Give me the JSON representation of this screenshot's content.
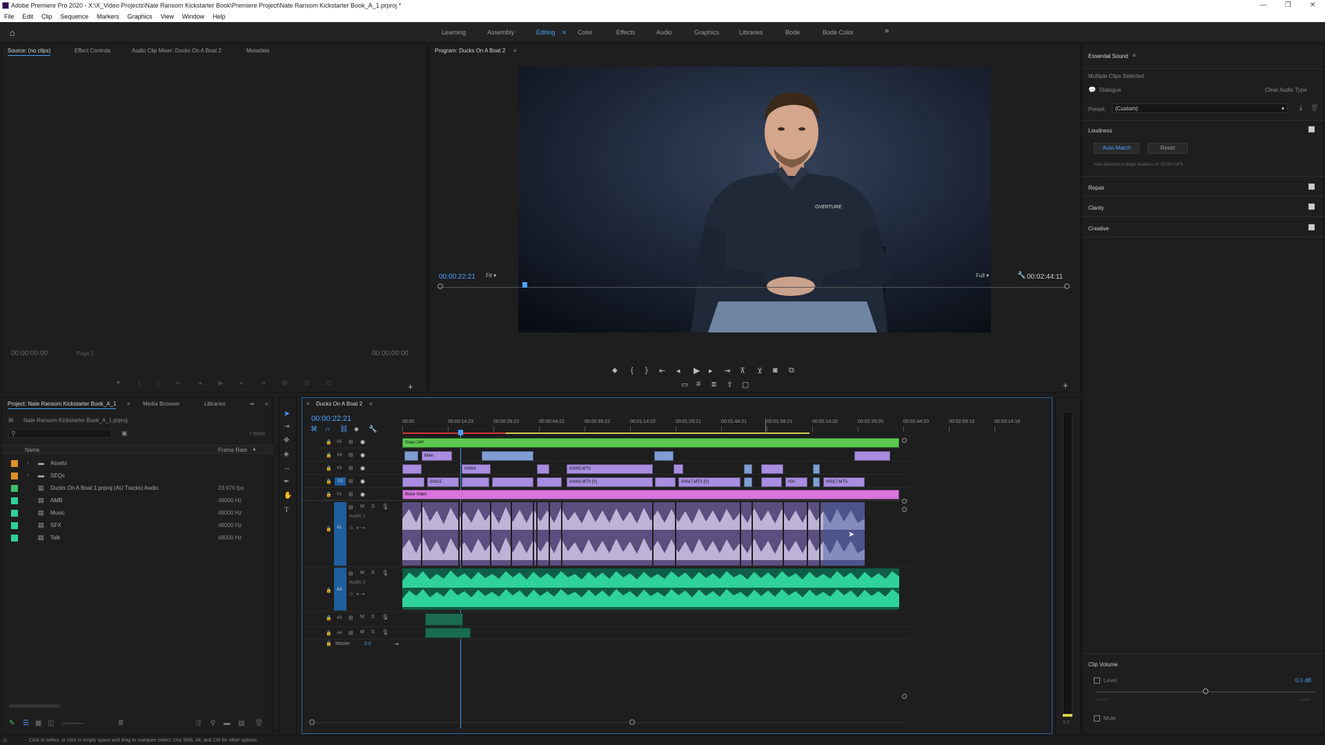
{
  "window": {
    "title": "Adobe Premiere Pro 2020 - X:\\X_Video Projects\\Nate Ransom Kickstarter Book\\Premiere Project\\Nate Ransom Kickstarter Book_A_1.prproj *"
  },
  "menu": [
    "File",
    "Edit",
    "Clip",
    "Sequence",
    "Markers",
    "Graphics",
    "View",
    "Window",
    "Help"
  ],
  "workspaces": [
    "Learning",
    "Assembly",
    "Editing",
    "Color",
    "Effects",
    "Audio",
    "Graphics",
    "Libraries",
    "Bode",
    "Bode Color"
  ],
  "active_workspace": "Editing",
  "source_panel": {
    "tabs": [
      "Source: (no clips)",
      "Effect Controls",
      "Audio Clip Mixer: Ducks On A Boat 2",
      "Metadata"
    ],
    "timecode_left": "00:00:00:00",
    "page": "Page 1",
    "timecode_right": "00:00:00:00"
  },
  "program_panel": {
    "title": "Program: Ducks On A Boat 2",
    "timecode": "00:00:22:21",
    "fit": "Fit",
    "resolution": "Full",
    "duration": "00:02:44:11",
    "shirt_logo": "OVERTURE",
    "playhead_fraction": 0.133
  },
  "essential_sound": {
    "title": "Essential Sound",
    "status": "Multiple Clips Selected",
    "type": "Dialogue",
    "clear": "Clear Audio Type",
    "preset_label": "Preset:",
    "preset_value": "(Custom)",
    "loudness": "Loudness",
    "auto_match": "Auto-Match",
    "reset": "Reset",
    "note": "Auto-Matched to target loudness of -23.00 LUFS",
    "sections": [
      "Repair",
      "Clarity",
      "Creative"
    ],
    "clip_volume": "Clip Volume",
    "level": "Level",
    "level_value": "0.0 dB",
    "quieter": "Quieter",
    "louder": "Louder",
    "mute": "Mute",
    "level_fraction": 0.5
  },
  "project_panel": {
    "tabs": [
      "Project: Nate Ransom Kickstarter Book_A_1",
      "Media Browser",
      "Libraries"
    ],
    "file": "Nate Ransom Kickstarter Book_A_1.prproj",
    "items_count": "7 Items",
    "col_name": "Name",
    "col_rate": "Frame Rate",
    "items": [
      {
        "name": "Assets",
        "rate": "",
        "color": "#e0902a",
        "kind": "folder"
      },
      {
        "name": "SEQs",
        "rate": "",
        "color": "#e0902a",
        "kind": "folder"
      },
      {
        "name": "Ducks On A Boat 1.prproj (AU Tracks) Audio",
        "rate": "23.976 fps",
        "color": "#3fc06a",
        "kind": "seq"
      },
      {
        "name": "AMB",
        "rate": "48000 Hz",
        "color": "#2fd29a",
        "kind": "audio"
      },
      {
        "name": "Music",
        "rate": "48000 Hz",
        "color": "#2fd29a",
        "kind": "audio"
      },
      {
        "name": "SFX",
        "rate": "48000 Hz",
        "color": "#2fd29a",
        "kind": "audio"
      },
      {
        "name": "Talk",
        "rate": "48000 Hz",
        "color": "#2fd29a",
        "kind": "audio"
      }
    ]
  },
  "timeline": {
    "sequence": "Ducks On A Boat 2",
    "timecode": "00:00:22:21",
    "ruler": [
      "00:00",
      "00:00:14:23",
      "00:00:29:23",
      "00:00:44:22",
      "00:00:59:22",
      "00:01:14:22",
      "00:01:29:21",
      "00:01:44:21",
      "00:01:59:21",
      "00:02:14:20",
      "00:02:29:20",
      "00:02:44:20",
      "00:02:59:19",
      "00:03:14:19"
    ],
    "tracks": {
      "v5": "V5",
      "v4": "V4",
      "v3": "V3",
      "v2": "V2",
      "v1": "V1",
      "a1": "A1",
      "a1_name": "Audio 1",
      "a2": "A2",
      "a2_name": "Audio 2",
      "a3": "A3",
      "a4": "A4",
      "master": "Master",
      "master_val": "0.0"
    },
    "clip_names": {
      "grain": "Grain 24P",
      "main": "Main",
      "c00004": "00004",
      "c00005": "00005.MTS",
      "c00015": "00015",
      "c00005v": "00005.MTS [V]",
      "c00017v": "00017.MTS [V]",
      "c000": "000",
      "c00017": "00017.MTS",
      "black": "Black Video"
    }
  },
  "status_bar": "Click to select, or click in empty space and drag to marquee select. Use Shift, Alt, and Ctrl for other options.",
  "colors": {
    "accent": "#4aa3ff",
    "video_green": "#5cc94f",
    "video_violet": "#a98de0",
    "video_blue": "#7f9fd4",
    "pink": "#d874dc",
    "audio_green": "#2fd29a"
  }
}
